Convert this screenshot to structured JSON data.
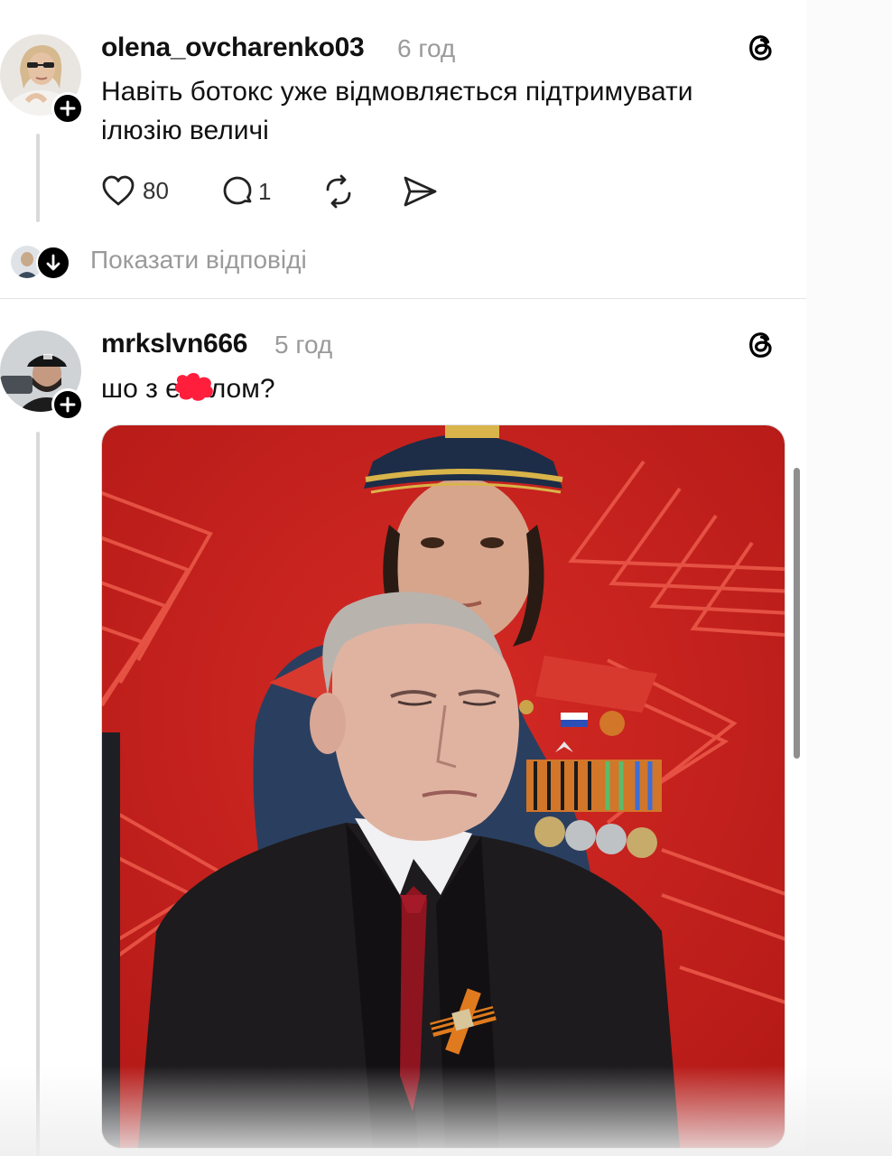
{
  "posts": [
    {
      "username": "olena_ovcharenko03",
      "time": "6 год",
      "text": "Навіть ботокс уже відмовляється підтримувати ілюзію величі",
      "likes": "80",
      "comments": "1",
      "show_replies": "Показати відповіді"
    },
    {
      "username": "mrkslvn666",
      "time": "5 год",
      "text": "шо з ебалом?",
      "text_censored_mark": "censored"
    }
  ],
  "icons": [
    "threads-logo-icon",
    "plus-icon",
    "heart-icon",
    "comment-icon",
    "repost-icon",
    "share-icon",
    "arrow-down-icon"
  ],
  "colors": {
    "accent": "#000000",
    "muted": "#9a9a9a",
    "poster_red": "#c8201d",
    "censor_red": "#ff1f3d"
  }
}
